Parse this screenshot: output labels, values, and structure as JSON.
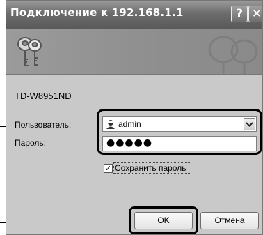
{
  "window": {
    "title": "Подключение к 192.168.1.1",
    "help_btn": "?",
    "close_btn": "✕"
  },
  "banner": {
    "icon": "keys-icon"
  },
  "form": {
    "device_name": "TD-W8951ND",
    "user_label": "Пользователь:",
    "user_value": "admin",
    "password_label": "Пароль:",
    "password_value": "●●●●●",
    "remember_label": "Сохранить пароль",
    "remember_checked": "✓"
  },
  "buttons": {
    "ok": "OK",
    "cancel": "Отмена"
  }
}
